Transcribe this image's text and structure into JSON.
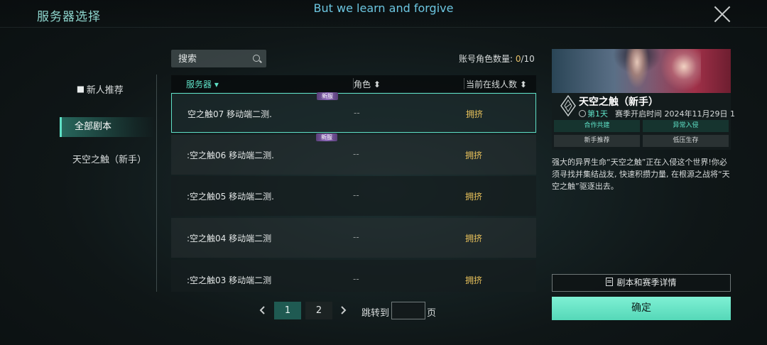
{
  "header": {
    "title": "服务器选择",
    "subtitle": "But we learn and forgive",
    "close_icon": "close-icon"
  },
  "nav": {
    "items": [
      {
        "label": "新人推荐",
        "icon": "butterfly-icon"
      },
      {
        "label": "全部剧本",
        "selected": true
      },
      {
        "label": "天空之触（新手）"
      }
    ]
  },
  "search": {
    "placeholder": "搜索"
  },
  "account": {
    "label": "账号角色数量: ",
    "current": "0",
    "max": "/10"
  },
  "table": {
    "headers": {
      "server": "服务器",
      "role": "角色",
      "online": "当前在线人数"
    },
    "rows": [
      {
        "name": "空之触07   移动端二测.",
        "role": "--",
        "status": "拥挤",
        "new_tag": "新服",
        "selected": true
      },
      {
        "name": ":空之触06   移动端二测.",
        "role": "--",
        "status": "拥挤",
        "new_tag": "新服"
      },
      {
        "name": ":空之触05   移动端二测.",
        "role": "--",
        "status": "拥挤"
      },
      {
        "name": ":空之触04   移动端二测",
        "role": "--",
        "status": "拥挤"
      },
      {
        "name": ":空之触03   移动端二测",
        "role": "--",
        "status": "拥挤"
      }
    ]
  },
  "pagination": {
    "page1": "1",
    "page2": "2",
    "jump_label": "跳转到",
    "jump_suffix": "页",
    "jump_value": ""
  },
  "panel": {
    "title": "天空之触（新手）",
    "day": "第1天",
    "season": "赛季开启时间 2024年11月29日 1",
    "tags": [
      "合作共建",
      "异常入侵",
      "新手推荐",
      "低压生存"
    ],
    "description": "强大的异界生命“天空之触”正在入侵这个世界!你必须寻找并集结战友, 快速积攒力量, 在根源之战将“天空之触”驱逐出去。",
    "detail_button": "剧本和赛季详情",
    "confirm_button": "确定"
  },
  "colors": {
    "accent": "#5fe0c6",
    "status": "#e9c25b",
    "confirm": "#6ee8c8",
    "title": "#8fd7cf"
  }
}
